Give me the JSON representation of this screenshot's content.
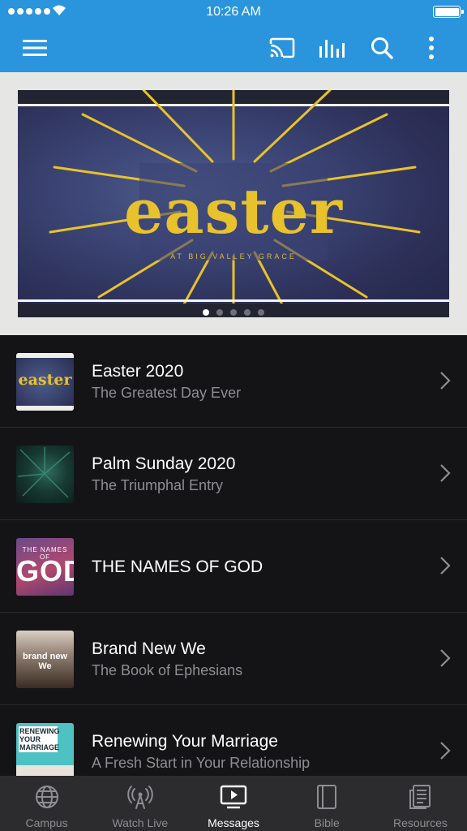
{
  "status_bar": {
    "time": "10:26 AM"
  },
  "toolbar": {
    "menu_icon": "hamburger-menu-icon",
    "cast_icon": "cast-icon",
    "audio_icon": "audio-bars-icon",
    "search_icon": "search-icon",
    "more_icon": "more-vertical-icon",
    "color": "#2a95dd"
  },
  "hero": {
    "title": "easter",
    "subtitle": "AT BIG VALLEY GRACE",
    "accent": "#e8c22d",
    "pages": 5,
    "active_page": 1
  },
  "series": [
    {
      "title": "Easter 2020",
      "subtitle": "The Greatest Day Ever",
      "thumb_text": "easter"
    },
    {
      "title": "Palm Sunday 2020",
      "subtitle": "The Triumphal Entry",
      "thumb_text": ""
    },
    {
      "title": "THE NAMES OF GOD",
      "subtitle": "",
      "thumb_text_top": "THE NAMES OF",
      "thumb_text_main": "GOD"
    },
    {
      "title": "Brand New We",
      "subtitle": "The Book of Ephesians",
      "thumb_text": "brand new We"
    },
    {
      "title": "Renewing Your Marriage",
      "subtitle": "A Fresh Start in Your Relationship",
      "thumb_text": "RENEWING YOUR MARRIAGE"
    }
  ],
  "tabs": [
    {
      "label": "Campus",
      "icon": "globe-icon"
    },
    {
      "label": "Watch Live",
      "icon": "broadcast-tower-icon"
    },
    {
      "label": "Messages",
      "icon": "play-screen-icon",
      "active": true
    },
    {
      "label": "Bible",
      "icon": "book-icon"
    },
    {
      "label": "Resources",
      "icon": "document-icon"
    }
  ]
}
